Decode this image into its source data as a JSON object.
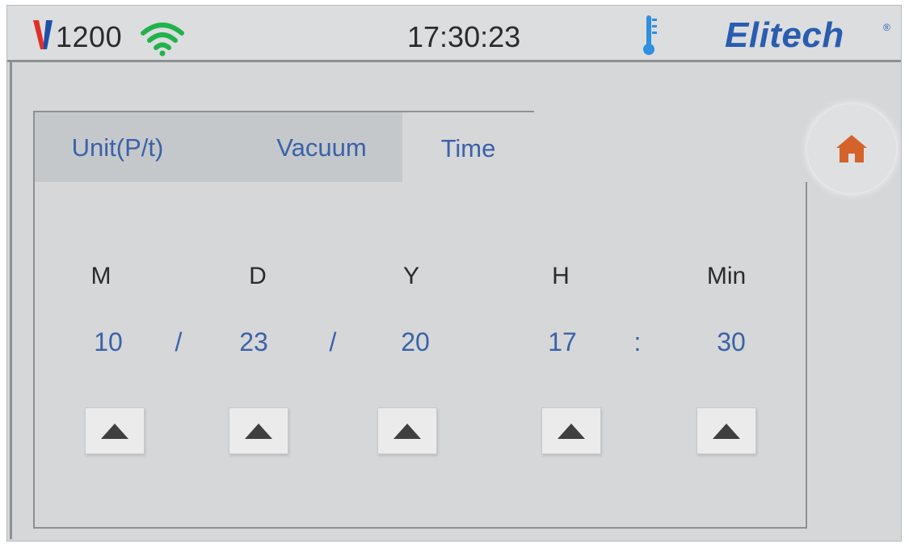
{
  "status_bar": {
    "battery_value": "1200",
    "battery_icon": "battery-v-icon",
    "wifi_icon": "wifi-icon",
    "time": "17:30:23",
    "thermo_icon": "thermometer-icon",
    "brand": "Elitech",
    "brand_mark": "®"
  },
  "colors": {
    "accent_blue": "#3a62a8",
    "wifi_green": "#22b24c",
    "thermo_blue": "#2f8fe0",
    "home_orange": "#d4622a",
    "battery_blue": "#1f4ea8",
    "battery_red": "#e0302a"
  },
  "tabs": [
    {
      "label": "Unit(P/t)",
      "active": false
    },
    {
      "label": "Vacuum",
      "active": false
    },
    {
      "label": "Time",
      "active": true
    }
  ],
  "home_button": {
    "icon": "home-icon"
  },
  "time_setting": {
    "fields": [
      {
        "label": "M",
        "value": "10"
      },
      {
        "label": "D",
        "value": "23"
      },
      {
        "label": "Y",
        "value": "20"
      },
      {
        "label": "H",
        "value": "17"
      },
      {
        "label": "Min",
        "value": "30"
      }
    ],
    "separators": [
      "/",
      "/",
      ":"
    ],
    "increment_icon": "triangle-up-icon"
  }
}
